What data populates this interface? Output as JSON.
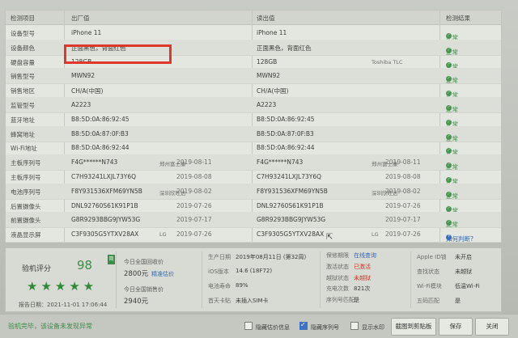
{
  "headers": {
    "item": "检测项目",
    "factory": "出厂值",
    "read": "读出值",
    "result": "检测结果"
  },
  "rows": [
    {
      "label": "设备型号",
      "factory": "iPhone 11",
      "f_extra": "",
      "f_date": "",
      "read": "iPhone 11",
      "r_extra": "",
      "r_date": "",
      "result": "正常"
    },
    {
      "label": "设备颜色",
      "factory": "正面黑色，背面红色",
      "f_extra": "",
      "f_date": "",
      "read": "正面黑色，背面红色",
      "r_extra": "",
      "r_date": "",
      "result": "正常"
    },
    {
      "label": "硬盘容量",
      "factory": "128GB",
      "f_extra": "",
      "f_date": "",
      "read": "128GB",
      "r_extra": "Toshiba TLC",
      "r_date": "",
      "result": "正常"
    },
    {
      "label": "销售型号",
      "factory": "MWN92",
      "f_extra": "",
      "f_date": "",
      "read": "MWN92",
      "r_extra": "",
      "r_date": "",
      "result": "正常"
    },
    {
      "label": "销售地区",
      "factory": "CH/A(中国)",
      "f_extra": "",
      "f_date": "",
      "read": "CH/A(中国)",
      "r_extra": "",
      "r_date": "",
      "result": "正常"
    },
    {
      "label": "监管型号",
      "factory": "A2223",
      "f_extra": "",
      "f_date": "",
      "read": "A2223",
      "r_extra": "",
      "r_date": "",
      "result": "正常"
    },
    {
      "label": "蓝牙地址",
      "factory": "B8:5D:0A:86:92:45",
      "f_extra": "",
      "f_date": "",
      "read": "B8:5D:0A:86:92:45",
      "r_extra": "",
      "r_date": "",
      "result": "正常"
    },
    {
      "label": "蜂窝地址",
      "factory": "B8:5D:0A:87:0F:B3",
      "f_extra": "",
      "f_date": "",
      "read": "B8:5D:0A:87:0F:B3",
      "r_extra": "",
      "r_date": "",
      "result": "正常"
    },
    {
      "label": "Wi-Fi地址",
      "factory": "B8:5D:0A:86:92:44",
      "f_extra": "",
      "f_date": "",
      "read": "B8:5D:0A:86:92:44",
      "r_extra": "",
      "r_date": "",
      "result": "正常"
    },
    {
      "label": "主板序列号",
      "factory": "F4G******N743",
      "f_extra": "郑州富士康",
      "f_date": "2019-08-11",
      "read": "F4G******N743",
      "r_extra": "郑州富士康",
      "r_date": "2019-08-11",
      "result": "正常"
    },
    {
      "label": "主板序列号",
      "factory": "C7H93241LXJL73Y6Q",
      "f_extra": "",
      "f_date": "2019-08-08",
      "read": "C7H93241LXJL73Y6Q",
      "r_extra": "",
      "r_date": "2019-08-08",
      "result": "正常"
    },
    {
      "label": "电池序列号",
      "factory": "F8Y931536XFM69YN5B",
      "f_extra": "深圳欣旺达",
      "f_date": "2019-08-02",
      "read": "F8Y931536XFM69YN5B",
      "r_extra": "深圳欣旺达",
      "r_date": "2019-08-02",
      "result": "正常"
    },
    {
      "label": "后置摄像头",
      "factory": "DNL92760S61K91P1B",
      "f_extra": "",
      "f_date": "2019-07-26",
      "read": "DNL92760S61K91P1B",
      "r_extra": "",
      "r_date": "2019-07-26",
      "result": "正常"
    },
    {
      "label": "前置摄像头",
      "factory": "G8R9293BBG9JYW53G",
      "f_extra": "",
      "f_date": "2019-07-17",
      "read": "G8R9293BBG9JYW53G",
      "r_extra": "",
      "r_date": "2019-07-17",
      "result": "正常"
    },
    {
      "label": "液晶显示屏",
      "factory": "C3F9305G5YTXV28AX",
      "f_extra": "LG",
      "f_date": "2019-07-26",
      "read": "C3F9305G5YTXV28AX",
      "r_extra": "LG",
      "r_date": "2019-07-26",
      "result": "如何判断?"
    }
  ],
  "score": {
    "label": "验机评分",
    "value": "98",
    "badge": "简",
    "stars": "★★★★★",
    "report_label": "报告日期：",
    "report_date": "2021-11-01 17:06:44"
  },
  "prices": {
    "today_label": "今日全国回收价",
    "today_value": "2800元",
    "today_link": "精准估价",
    "yesterday_label": "今日全国销售价",
    "yesterday_value": "2940元"
  },
  "info_mid": [
    {
      "k": "生产日期",
      "v": "2019年08月11日 (第32周)"
    },
    {
      "k": "iOS版本",
      "v": "14.6 (18F72)"
    },
    {
      "k": "电池寿命",
      "v": "89%"
    },
    {
      "k": "首天卡贴",
      "v": "未插入SIM卡"
    }
  ],
  "info_right": [
    {
      "k": "保修期限",
      "v": "在线查询"
    },
    {
      "k": "激活状态",
      "v": "已激活"
    },
    {
      "k": "越狱状态",
      "v": "未越狱"
    },
    {
      "k": "充电次数",
      "v": "821次"
    },
    {
      "k": "序列号匹配",
      "v": "是"
    }
  ],
  "info_far": [
    {
      "k": "Apple ID锁",
      "v": "未开启"
    },
    {
      "k": "查找状态",
      "v": "未越狱"
    },
    {
      "k": "Wi-Fi模块",
      "v": "低温Wi-Fi"
    },
    {
      "k": "五码匹配",
      "v": "是"
    }
  ],
  "status": {
    "message": "验机完毕，该设备未发现异常",
    "cb1": "隐藏估价信息",
    "cb2": "隐藏序列号",
    "cb3": "显示水印",
    "btn_shot": "截图到剪贴板",
    "btn_save": "保存",
    "btn_close": "关闭"
  }
}
